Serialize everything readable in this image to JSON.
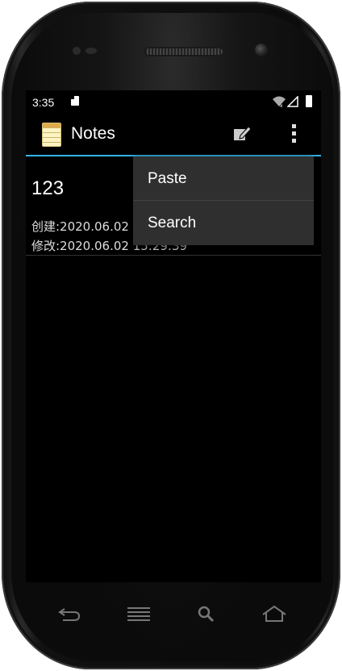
{
  "status_bar": {
    "time": "3:35",
    "icons": [
      "sd-card-icon",
      "wifi-icon",
      "signal-icon",
      "battery-icon"
    ]
  },
  "action_bar": {
    "title": "Notes",
    "icons": [
      "notes-app-icon",
      "compose-icon",
      "overflow-menu-icon"
    ],
    "accent_color": "#33b5e5"
  },
  "notes": [
    {
      "title": "123",
      "created": "创建:2020.06.02",
      "modified": "修改:2020.06.02 15:29:39"
    }
  ],
  "menu": {
    "items": [
      "Paste",
      "Search"
    ]
  },
  "nav_bar": {
    "icons": [
      "back-icon",
      "menu-icon",
      "search-icon",
      "home-icon"
    ]
  }
}
